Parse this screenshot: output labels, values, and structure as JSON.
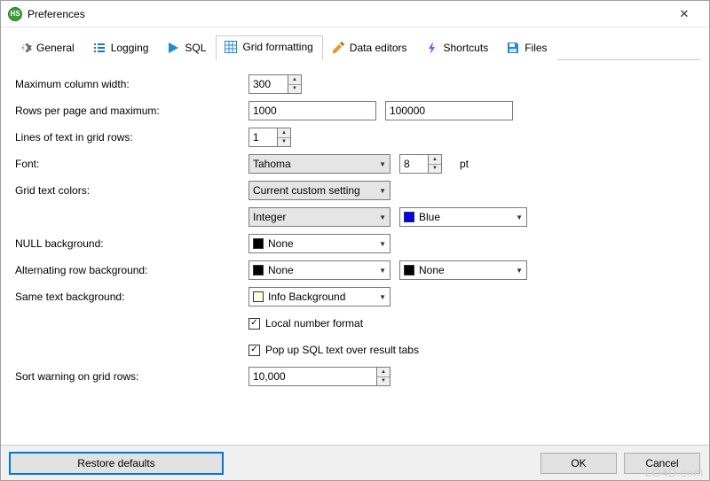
{
  "window": {
    "title": "Preferences"
  },
  "tabs": {
    "general": "General",
    "logging": "Logging",
    "sql": "SQL",
    "grid_formatting": "Grid formatting",
    "data_editors": "Data editors",
    "shortcuts": "Shortcuts",
    "files": "Files"
  },
  "labels": {
    "max_col_width": "Maximum column width:",
    "rows_per_page": "Rows per page and maximum:",
    "lines_of_text": "Lines of text in grid rows:",
    "font": "Font:",
    "grid_text_colors": "Grid text colors:",
    "null_background": "NULL background:",
    "alternating": "Alternating row background:",
    "same_text_bg": "Same text background:",
    "sort_warning": "Sort warning on grid rows:",
    "pt": "pt"
  },
  "values": {
    "max_col_width": "300",
    "rows_per_page": "1000",
    "rows_maximum": "100000",
    "lines_of_text": "1",
    "font_name": "Tahoma",
    "font_size": "8",
    "text_color_mode": "Current custom setting",
    "data_type": "Integer",
    "data_type_color": "Blue",
    "null_bg": "None",
    "alt_bg_1": "None",
    "alt_bg_2": "None",
    "same_text_bg": "Info Background",
    "sort_warning": "10,000"
  },
  "checkboxes": {
    "local_number_format": "Local number format",
    "popup_sql": "Pop up SQL text over result tabs"
  },
  "buttons": {
    "restore": "Restore defaults",
    "ok": "OK",
    "cancel": "Cancel"
  },
  "colors": {
    "black": "#000000",
    "blue": "#0000ff",
    "info_bg": "#ffffe1"
  },
  "watermark": "LO4D.com"
}
